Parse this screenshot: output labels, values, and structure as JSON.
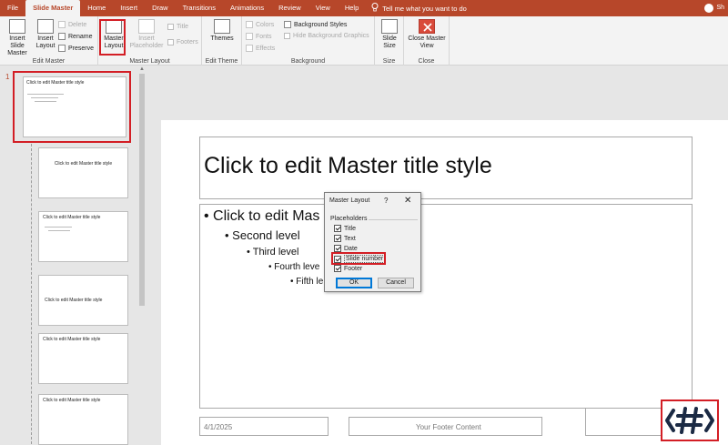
{
  "tabs": [
    "File",
    "Slide Master",
    "Home",
    "Insert",
    "Draw",
    "Transitions",
    "Animations",
    "Review",
    "View",
    "Help"
  ],
  "tell_me": "Tell me what you want to do",
  "user_initials": "Sh",
  "ribbon": {
    "edit_master": {
      "label": "Edit Master",
      "insert_slide_master": "Insert Slide Master",
      "insert_layout": "Insert Layout",
      "delete": "Delete",
      "rename": "Rename",
      "preserve": "Preserve"
    },
    "master_layout": {
      "label": "Master Layout",
      "master_layout_btn": "Master Layout",
      "insert_placeholder": "Insert Placeholder",
      "title": "Title",
      "footers": "Footers"
    },
    "edit_theme": {
      "label": "Edit Theme",
      "themes": "Themes"
    },
    "background": {
      "label": "Background",
      "colors": "Colors",
      "fonts": "Fonts",
      "effects": "Effects",
      "background_styles": "Background Styles",
      "hide_background_graphics": "Hide Background Graphics"
    },
    "size": {
      "label": "Size",
      "slide_size": "Slide Size"
    },
    "close": {
      "label": "Close",
      "close_master_view": "Close Master View"
    }
  },
  "thumbnails": {
    "first_number": "1",
    "master_title": "Click to edit Master title style",
    "layout_title": "Click to edit Master title style"
  },
  "slide": {
    "title": "Click to edit Master title style",
    "bullets": [
      "Click to edit Mas",
      "Second level",
      "Third level",
      "Fourth leve",
      "Fifth le"
    ],
    "date": "4/1/2025",
    "footer": "Your Footer Content"
  },
  "dialog": {
    "title": "Master Layout",
    "help": "?",
    "close": "✕",
    "section": "Placeholders",
    "options": [
      "Title",
      "Text",
      "Date",
      "Slide number",
      "Footer"
    ],
    "ok": "OK",
    "cancel": "Cancel"
  },
  "logo_text": "{#}"
}
